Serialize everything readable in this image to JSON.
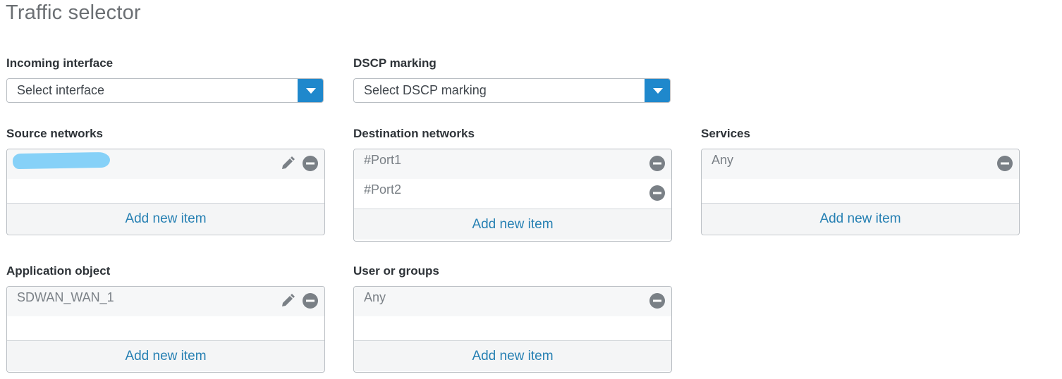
{
  "page": {
    "title": "Traffic selector"
  },
  "incoming_interface": {
    "label": "Incoming interface",
    "value": "Select interface"
  },
  "dscp_marking": {
    "label": "DSCP marking",
    "value": "Select DSCP marking"
  },
  "source_networks": {
    "label": "Source networks",
    "add_label": "Add new item"
  },
  "destination_networks": {
    "label": "Destination networks",
    "items": [
      "#Port1",
      "#Port2"
    ],
    "add_label": "Add new item"
  },
  "services": {
    "label": "Services",
    "items": [
      "Any"
    ],
    "add_label": "Add new item"
  },
  "application_object": {
    "label": "Application object",
    "items": [
      "SDWAN_WAN_1"
    ],
    "add_label": "Add new item"
  },
  "user_or_groups": {
    "label": "User or groups",
    "items": [
      "Any"
    ],
    "add_label": "Add new item"
  },
  "colors": {
    "accent": "#1f88cc",
    "link": "#2680b3",
    "icon": "#7a8086",
    "redaction": "#86d1f8"
  }
}
